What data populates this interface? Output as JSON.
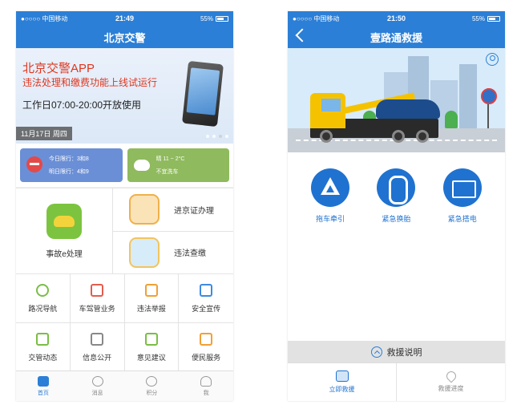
{
  "left": {
    "status": {
      "carrier": "●○○○○ 中国移动",
      "time": "21:49",
      "battery": "55%"
    },
    "title": "北京交警",
    "banner": {
      "title": "北京交警APP",
      "subtitle": "违法处理和缴费功能上线试运行",
      "hours": "工作日07:00-20:00开放使用",
      "date": "11月17日  周四"
    },
    "traffic": {
      "today": "今日限行：3和8",
      "tomorrow": "明日限行：4和9"
    },
    "weather": {
      "temp": "晴 11 ~ 2°C",
      "advice": "不宜洗车"
    },
    "accident_label": "事故e处理",
    "permit_label": "进京证办理",
    "violation_label": "违法查缴",
    "grid": [
      {
        "label": "路况导航",
        "icon": "location-icon"
      },
      {
        "label": "车驾管业务",
        "icon": "document-icon"
      },
      {
        "label": "违法举报",
        "icon": "camera-icon"
      },
      {
        "label": "安全宣传",
        "icon": "shield-icon"
      },
      {
        "label": "交管动态",
        "icon": "message-icon"
      },
      {
        "label": "信息公开",
        "icon": "megaphone-icon"
      },
      {
        "label": "意见建议",
        "icon": "edit-icon"
      },
      {
        "label": "便民服务",
        "icon": "home-icon"
      }
    ],
    "tabs": [
      {
        "label": "首页",
        "icon": "home-tab-icon"
      },
      {
        "label": "消息",
        "icon": "chat-tab-icon"
      },
      {
        "label": "积分",
        "icon": "points-tab-icon"
      },
      {
        "label": "我",
        "icon": "profile-tab-icon"
      }
    ]
  },
  "right": {
    "status": {
      "carrier": "●○○○○ 中国移动",
      "time": "21:50",
      "battery": "55%"
    },
    "title": "壹路通救援",
    "services": [
      {
        "label": "拖车牵引",
        "icon": "warning-triangle-icon"
      },
      {
        "label": "紧急换胎",
        "icon": "tire-icon"
      },
      {
        "label": "紧急搭电",
        "icon": "battery-icon"
      }
    ],
    "explain": "救援说明",
    "tabs": [
      {
        "label": "立即救援",
        "icon": "tow-truck-icon"
      },
      {
        "label": "救援进度",
        "icon": "location-pin-icon"
      }
    ]
  },
  "colors": {
    "primary": "#2c7fd6",
    "alert": "#e0361e",
    "green": "#8fba5e"
  }
}
